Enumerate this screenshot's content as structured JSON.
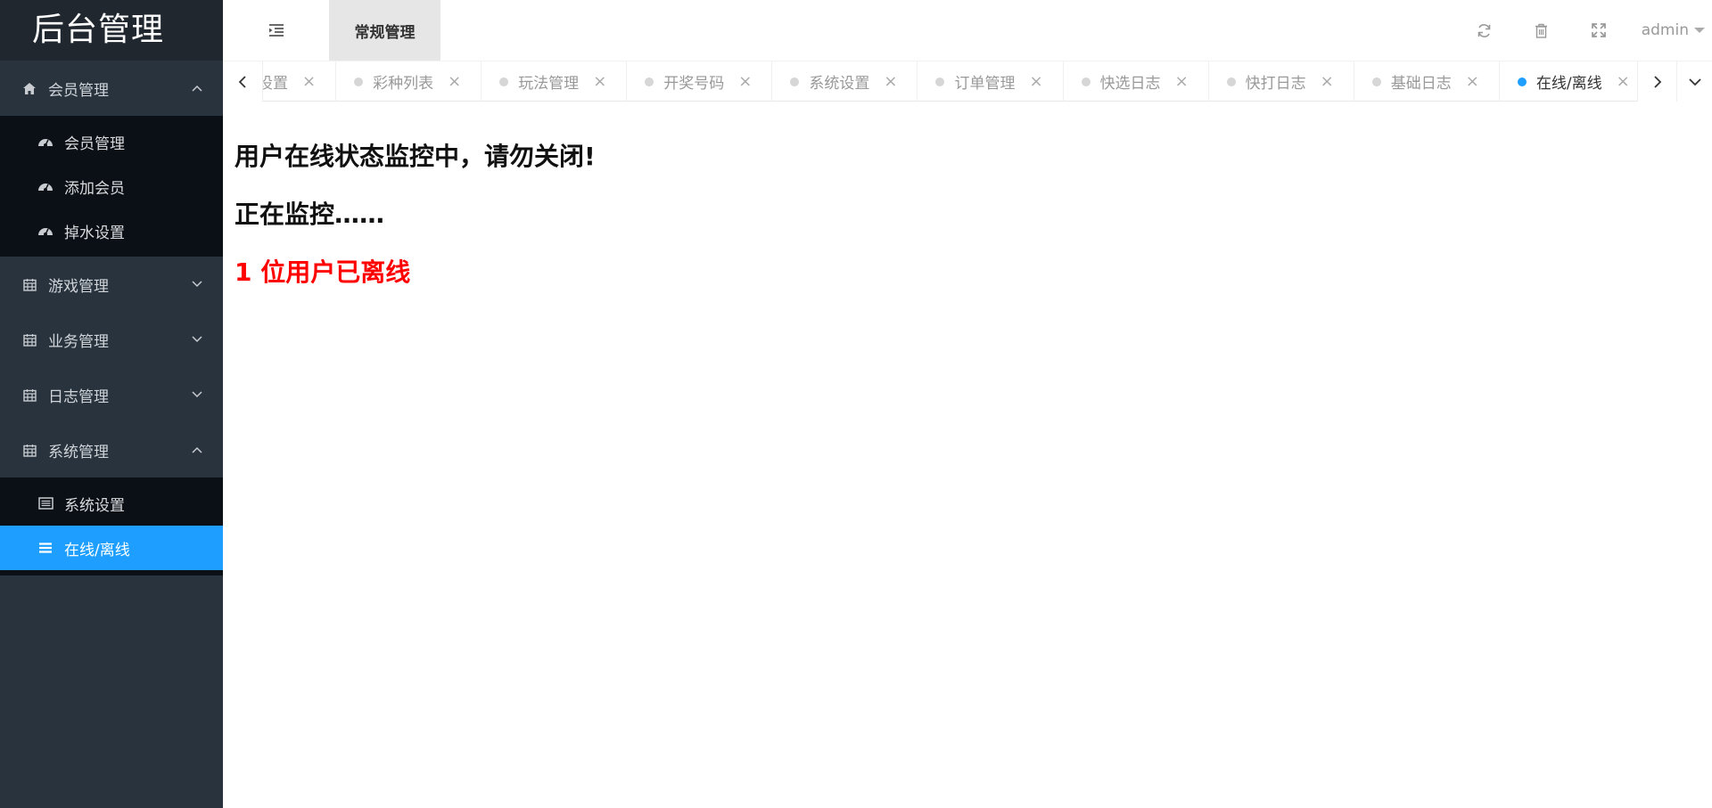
{
  "app": {
    "title": "后台管理"
  },
  "header": {
    "active_top_tab": "常规管理",
    "user": "admin",
    "tools": [
      "refresh-icon",
      "trash-icon",
      "fullscreen-icon"
    ]
  },
  "sidebar": {
    "groups": [
      {
        "label": "会员管理",
        "icon": "home-icon",
        "expanded": true,
        "items": [
          {
            "label": "会员管理",
            "icon": "dashboard-icon"
          },
          {
            "label": "添加会员",
            "icon": "dashboard-icon"
          },
          {
            "label": "掉水设置",
            "icon": "dashboard-icon"
          }
        ]
      },
      {
        "label": "游戏管理",
        "icon": "calendar-icon",
        "expanded": false
      },
      {
        "label": "业务管理",
        "icon": "calendar-icon",
        "expanded": false
      },
      {
        "label": "日志管理",
        "icon": "calendar-icon",
        "expanded": false
      },
      {
        "label": "系统管理",
        "icon": "calendar-icon",
        "expanded": true,
        "items": [
          {
            "label": "系统设置",
            "icon": "list-alt-icon"
          },
          {
            "label": "在线/离线",
            "icon": "bars-icon",
            "active": true
          }
        ]
      }
    ]
  },
  "tabs": [
    {
      "label": "掉水设置"
    },
    {
      "label": "彩种列表"
    },
    {
      "label": "玩法管理"
    },
    {
      "label": "开奖号码"
    },
    {
      "label": "系统设置"
    },
    {
      "label": "订单管理"
    },
    {
      "label": "快选日志"
    },
    {
      "label": "快打日志"
    },
    {
      "label": "基础日志"
    },
    {
      "label": "在线/离线",
      "active": true
    }
  ],
  "main": {
    "line1": "用户在线状态监控中，请勿关闭!",
    "line2": "正在监控……",
    "line3": "1 位用户已离线"
  },
  "colors": {
    "accent": "#1e9fff",
    "sidebar_bg": "#28333e",
    "alert": "#ff0000"
  }
}
